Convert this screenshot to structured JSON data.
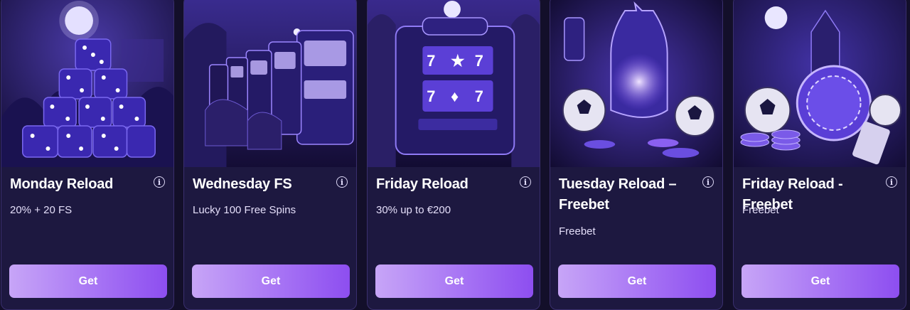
{
  "cards": [
    {
      "title": "Monday Reload",
      "subtitle": "20% + 20 FS",
      "button": "Get",
      "art": "dice-pyramid-image"
    },
    {
      "title": "Wednesday FS",
      "subtitle": "Lucky 100 Free Spins",
      "button": "Get",
      "art": "slot-machines-image"
    },
    {
      "title": "Friday Reload",
      "subtitle": "30% up to €200",
      "button": "Get",
      "art": "slot-machine-image"
    },
    {
      "title": "Tuesday Reload – Freebet",
      "subtitle": "Freebet",
      "button": "Get",
      "art": "football-lantern-image"
    },
    {
      "title": "Friday Reload - Freebet",
      "subtitle": "Freebet",
      "button": "Get",
      "art": "football-chips-image"
    }
  ],
  "info_glyph": "i",
  "colors": {
    "card_bg": "#1d1840",
    "card_border": "#3a2f6e",
    "button_gradient_start": "#c7a5f7",
    "button_gradient_end": "#8d4ef0",
    "text_primary": "#ffffff",
    "text_secondary": "#e4def9"
  }
}
